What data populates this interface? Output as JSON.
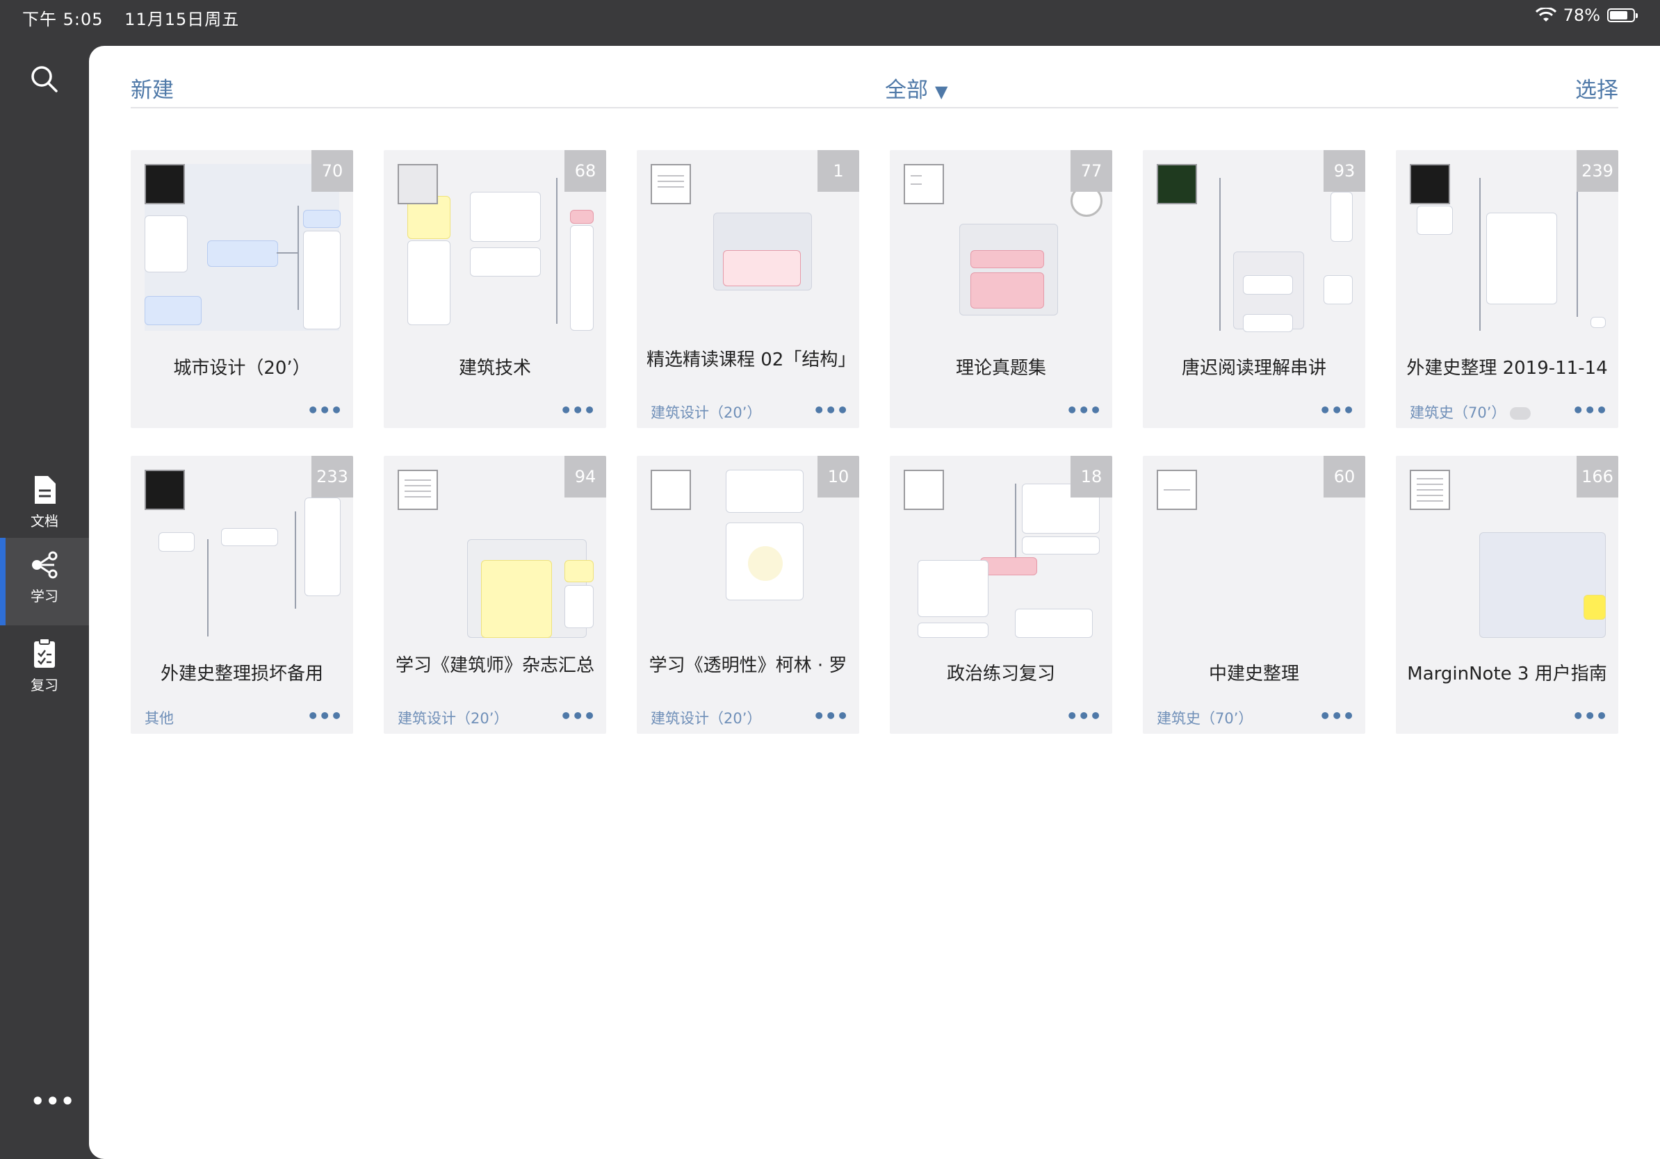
{
  "status": {
    "time": "下午 5:05",
    "date": "11月15日周五",
    "battery": "78%",
    "battery_level": 0.78
  },
  "sidebar": {
    "items": [
      {
        "label": "文档",
        "icon": "document-icon"
      },
      {
        "label": "学习",
        "icon": "mindmap-icon",
        "active": true
      },
      {
        "label": "复习",
        "icon": "clipboard-icon"
      }
    ],
    "more": "•••"
  },
  "toolbar": {
    "new": "新建",
    "filter": "全部",
    "filter_arrow": "▼",
    "select": "选择"
  },
  "cards": [
    {
      "title": "城市设计（20’）",
      "badge": "70",
      "tag": ""
    },
    {
      "title": "建筑技术",
      "badge": "68",
      "tag": ""
    },
    {
      "title": "精选精读课程 02「结构」",
      "badge": "1",
      "tag": "建筑设计（20’）"
    },
    {
      "title": "理论真题集",
      "badge": "77",
      "tag": ""
    },
    {
      "title": "唐迟阅读理解串讲",
      "badge": "93",
      "tag": ""
    },
    {
      "title": "外建史整理 2019-11-14",
      "badge": "239",
      "tag": "建筑史（70’）"
    },
    {
      "title": "外建史整理损坏备用",
      "badge": "233",
      "tag": "其他"
    },
    {
      "title": "学习《建筑师》杂志汇总",
      "badge": "94",
      "tag": "建筑设计（20’）"
    },
    {
      "title": "学习《透明性》柯林 · 罗",
      "badge": "10",
      "tag": "建筑设计（20’）"
    },
    {
      "title": "政治练习复习",
      "badge": "18",
      "tag": ""
    },
    {
      "title": "中建史整理",
      "badge": "60",
      "tag": "建筑史（70’）"
    },
    {
      "title": "MarginNote 3 用户指南",
      "badge": "166",
      "tag": ""
    }
  ],
  "more_label": "•••"
}
